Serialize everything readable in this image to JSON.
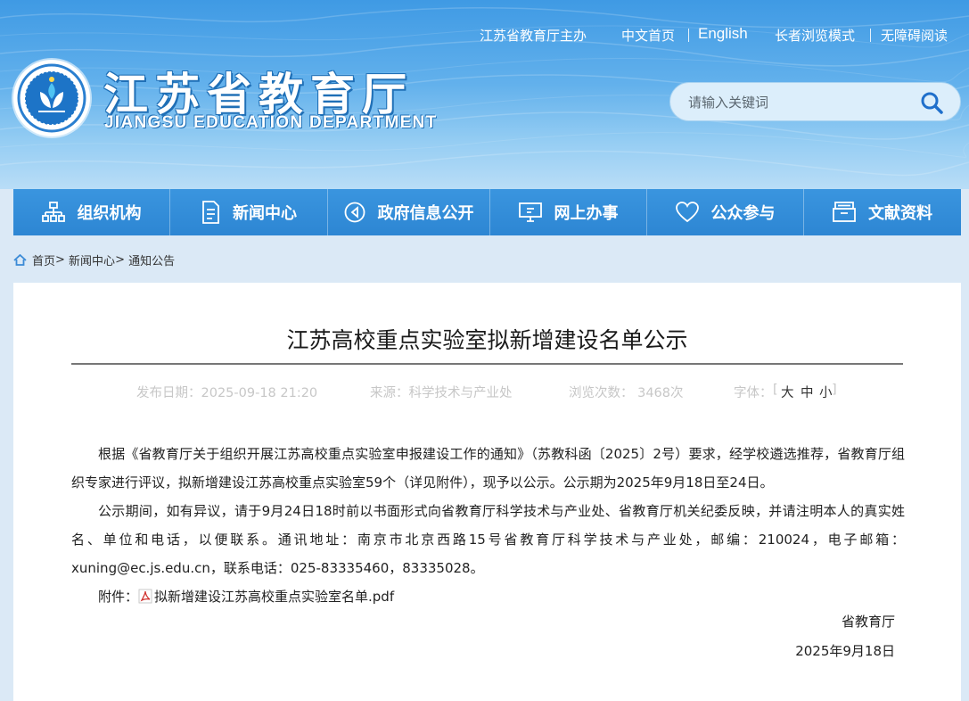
{
  "header": {
    "host_text": "江苏省教育厅主办",
    "links": {
      "home_cn": "中文首页",
      "english": "English",
      "elder_mode": "长者浏览模式",
      "accessible": "无障碍阅读"
    },
    "logo_title": "江苏省教育厅",
    "logo_subtitle": "JIANGSU EDUCATION DEPARTMENT"
  },
  "search": {
    "placeholder": "请输入关键词"
  },
  "nav": [
    {
      "label": "组织机构",
      "icon": "org-chart-icon"
    },
    {
      "label": "新闻中心",
      "icon": "document-icon"
    },
    {
      "label": "政府信息公开",
      "icon": "speaker-icon"
    },
    {
      "label": "网上办事",
      "icon": "monitor-icon"
    },
    {
      "label": "公众参与",
      "icon": "heart-icon"
    },
    {
      "label": "文献资料",
      "icon": "archive-icon"
    }
  ],
  "breadcrumb": {
    "home": "首页",
    "news": "新闻中心",
    "notices": "通知公告"
  },
  "article": {
    "title": "江苏高校重点实验室拟新增建设名单公示",
    "publish_date": "发布日期：2025-09-18 21:20",
    "source": "来源：科学技术与产业处",
    "views": "浏览次数： 3468次",
    "font_label": "字体：",
    "font_large": "大",
    "font_medium": "中",
    "font_small": "小",
    "paragraph1": "根据《省教育厅关于组织开展江苏高校重点实验室申报建设工作的通知》（苏教科函〔2025〕2号）要求，经学校遴选推荐，省教育厅组织专家进行评议，拟新增建设江苏高校重点实验室59个（详见附件），现予以公示。公示期为2025年9月18日至24日。",
    "paragraph2": "公示期间，如有异议，请于9月24日18时前以书面形式向省教育厅科学技术与产业处、省教育厅机关纪委反映，并请注明本人的真实姓名、单位和电话，以便联系。通讯地址：南京市北京西路15号省教育厅科学技术与产业处，邮编：210024，电子邮箱：xuning@ec.js.edu.cn，联系电话：025-83335460，83335028。",
    "attachment_label": "附件：",
    "attachment_name": "拟新增建设江苏高校重点实验室名单.pdf",
    "signature": "省教育厅",
    "sign_date": "2025年9月18日"
  },
  "colors": {
    "header_blue": "#3f9ae4",
    "nav_blue": "#2d86d3",
    "search_bg": "#dceefb",
    "page_bg": "#dbe9f6"
  }
}
